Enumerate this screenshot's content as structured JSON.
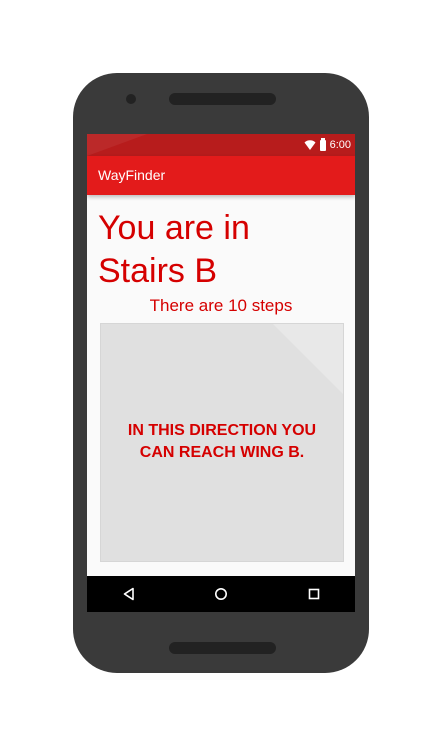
{
  "status_bar": {
    "time": "6:00",
    "icons": [
      "wifi-icon",
      "battery-icon"
    ]
  },
  "app_bar": {
    "title": "WayFinder"
  },
  "main": {
    "headline_line1": "You are in",
    "headline_line2": "Stairs B",
    "steps_text": "There are 10 steps",
    "direction_line1": "IN THIS DIRECTION YOU",
    "direction_line2": "CAN REACH WING B."
  },
  "nav_bar": {
    "icons": [
      "back-icon",
      "home-icon",
      "recents-icon"
    ]
  },
  "colors": {
    "accent": "#e31b1b",
    "status_bar": "#b71c1c",
    "text_red": "#d50000",
    "card_bg": "#e0e0e0"
  }
}
